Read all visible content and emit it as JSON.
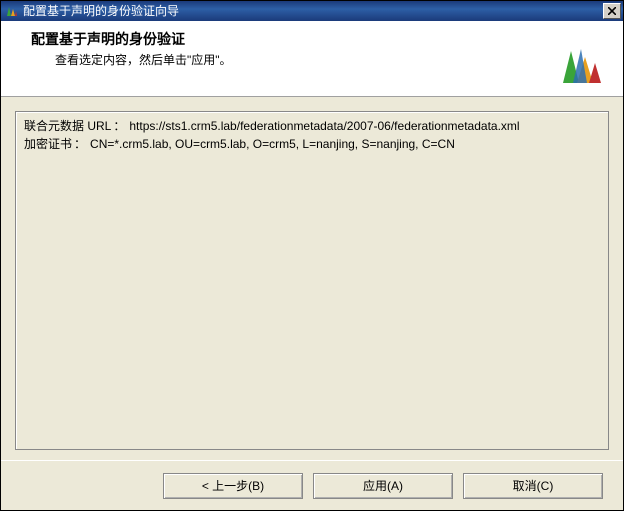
{
  "titlebar": {
    "title": "配置基于声明的身份验证向导"
  },
  "header": {
    "title": "配置基于声明的身份验证",
    "subtitle": "查看选定内容，然后单击\"应用\"。"
  },
  "details": {
    "metadata_label": "联合元数据  URL",
    "metadata_value": "https://sts1.crm5.lab/federationmetadata/2007-06/federationmetadata.xml",
    "cert_label": "加密证书",
    "cert_value": "CN=*.crm5.lab, OU=crm5.lab, O=crm5, L=nanjing, S=nanjing, C=CN"
  },
  "buttons": {
    "back": "< 上一步(B)",
    "apply": "应用(A)",
    "cancel": "取消(C)"
  },
  "colors": {
    "titlebar": "#1b3a7a",
    "bg": "#ece9d8"
  }
}
